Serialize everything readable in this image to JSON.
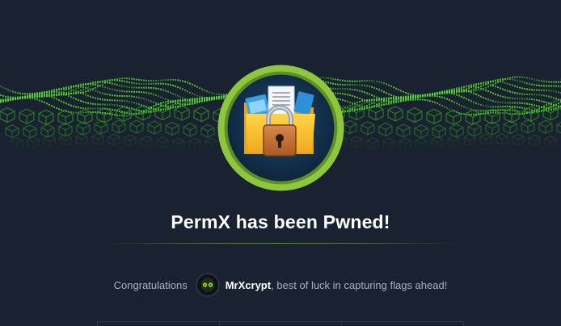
{
  "machine": {
    "title": "PermX has been Pwned!"
  },
  "message": {
    "prefix": "Congratulations",
    "username": "MrXcrypt",
    "suffix": ", best of luck in capturing flags ahead!"
  },
  "colors": {
    "background": "#1a2130",
    "accent": "#9fef00",
    "badge_ring": "#8dc63f",
    "text_muted": "#a4b1cd"
  },
  "icons": {
    "badge": "locked-folder-icon",
    "avatar": "user-avatar-skull-icon"
  }
}
